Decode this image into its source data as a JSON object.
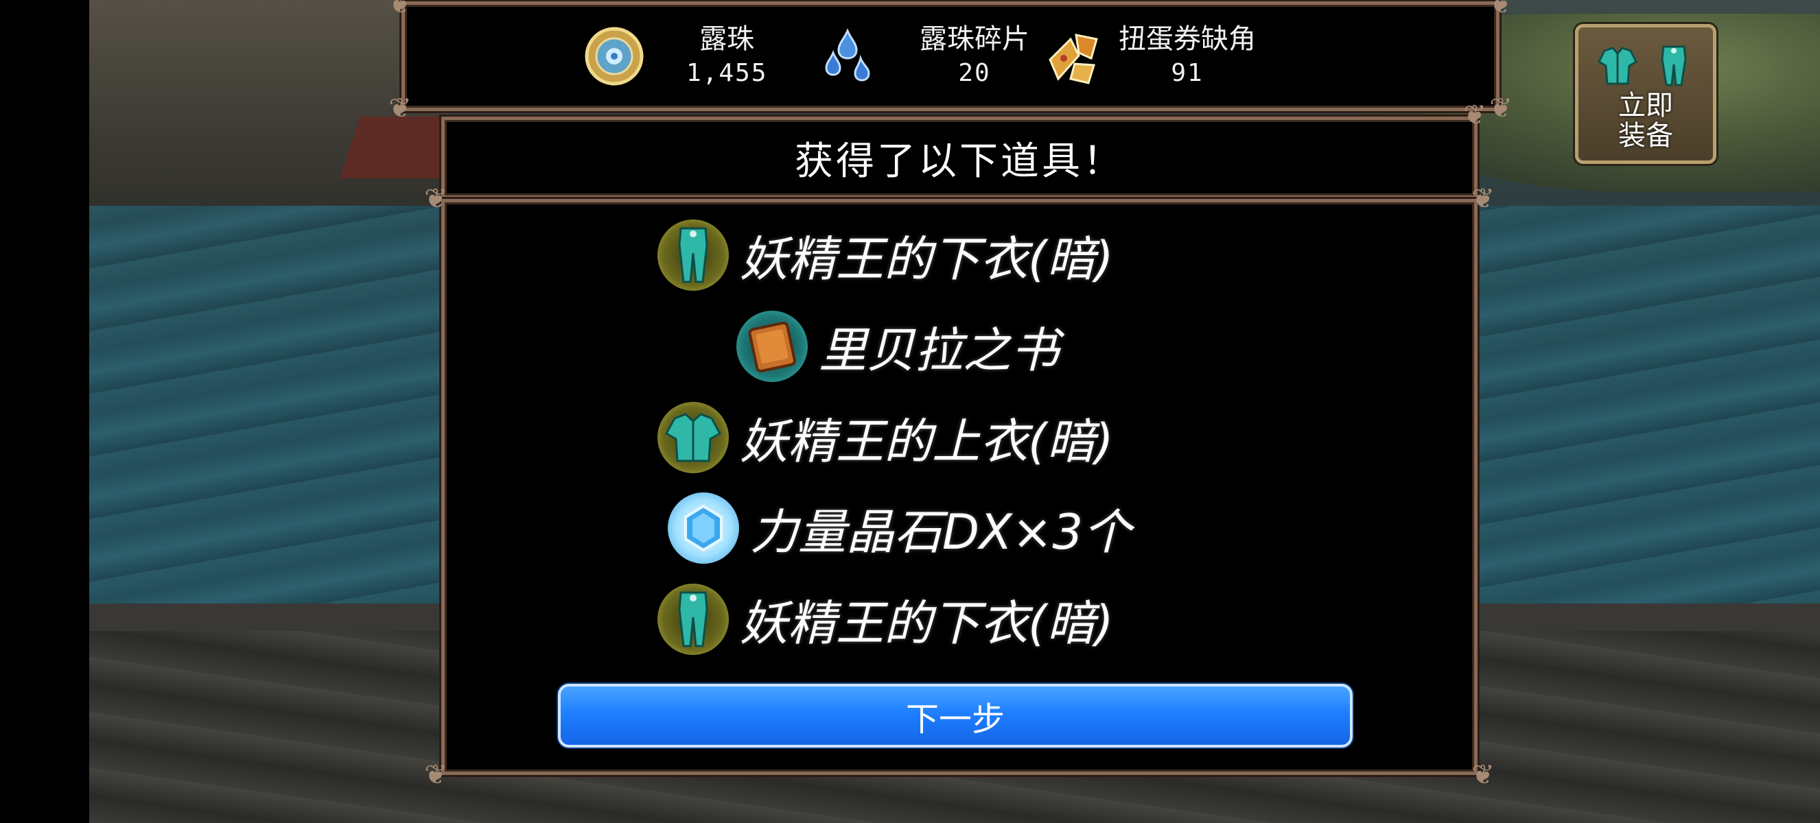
{
  "currencies": [
    {
      "label": "露珠",
      "value": "1,455",
      "icon": "dew-orb-icon"
    },
    {
      "label": "露珠碎片",
      "value": "20",
      "icon": "dew-shard-icon"
    },
    {
      "label": "扭蛋券缺角",
      "value": "91",
      "icon": "gacha-ticket-fragment-icon"
    }
  ],
  "equip_button": {
    "label": "立即\n装备",
    "icon": "armor-icon"
  },
  "dialog": {
    "title": "获得了以下道具！",
    "items": [
      {
        "name": "妖精王的下衣(暗)",
        "icon": "fairy-king-pants-icon"
      },
      {
        "name": "里贝拉之书",
        "icon": "book-icon"
      },
      {
        "name": "妖精王的上衣(暗)",
        "icon": "fairy-king-top-icon"
      },
      {
        "name": "力量晶石DX×3个",
        "icon": "power-crystal-icon"
      },
      {
        "name": "妖精王的下衣(暗)",
        "icon": "fairy-king-pants-icon"
      }
    ],
    "next_label": "下一步"
  },
  "colors": {
    "frame_border": "#8a6a55",
    "next_button": "#1e7fff",
    "equip_button_border": "#b8a070",
    "armor_teal": "#2fb8a8"
  }
}
